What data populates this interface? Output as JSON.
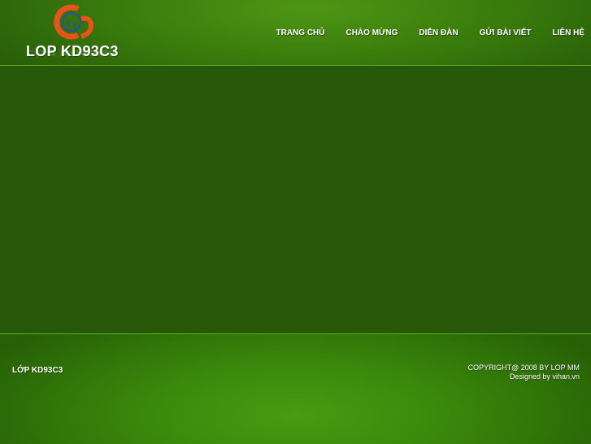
{
  "header": {
    "site_title": "LOP KD93C3",
    "logo_icon": "lop-cs-logo-icon",
    "nav": [
      {
        "label": "TRANG CHỦ"
      },
      {
        "label": "CHÀO MỪNG"
      },
      {
        "label": "DIỄN ĐÀN"
      },
      {
        "label": "GỬI BÀI VIẾT"
      },
      {
        "label": "LIÊN HỆ"
      }
    ]
  },
  "footer": {
    "left_text": "LỚP KD93C3",
    "copyright": "COPYRIGHT@ 2008 BY LOP MM",
    "designed_by": "Designed by vihan.vn"
  },
  "colors": {
    "header_green": "#3a7c0c",
    "main_green": "#275808",
    "footer_green": "#3b8a0c",
    "logo_orange": "#e8531c",
    "logo_blue": "#2a4fa8"
  }
}
